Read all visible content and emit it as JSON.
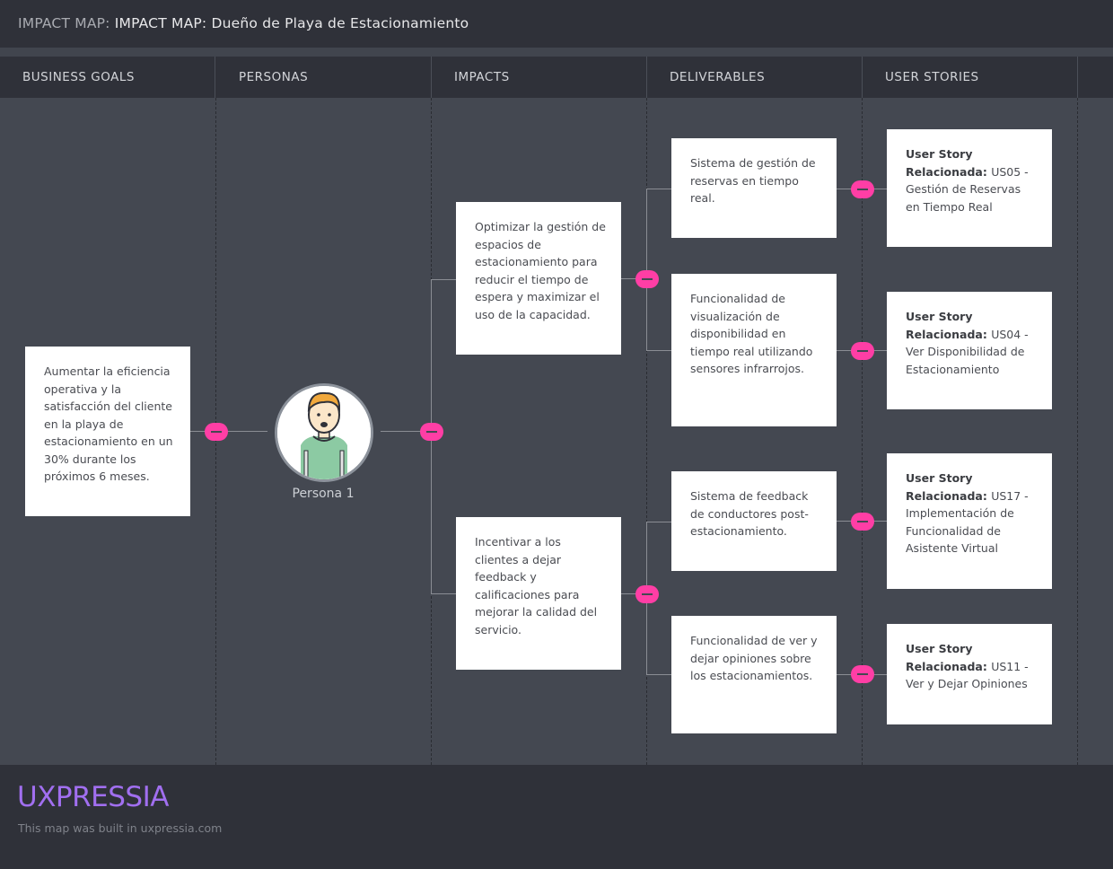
{
  "header": {
    "title_prefix": "IMPACT MAP:",
    "title": "IMPACT MAP: Dueño de Playa de Estacionamiento"
  },
  "columns": [
    "BUSINESS GOALS",
    "PERSONAS",
    "IMPACTS",
    "DELIVERABLES",
    "USER STORIES"
  ],
  "business_goal": {
    "text": "Aumentar la eficiencia operativa y la satisfacción del cliente en la playa de estacionamiento en un 30% durante los próximos 6 meses."
  },
  "persona": {
    "label": "Persona 1"
  },
  "impacts": [
    {
      "text": "Optimizar la gestión de espacios de estacionamiento para reducir el tiempo de espera y maximizar el uso de la capacidad."
    },
    {
      "text": "Incentivar a los clientes a dejar feedback y calificaciones para mejorar la calidad del servicio."
    }
  ],
  "deliverables": [
    {
      "text": "Sistema de gestión de reservas en tiempo real."
    },
    {
      "text": "Funcionalidad de visualización de disponibilidad en tiempo real utilizando sensores infrarrojos."
    },
    {
      "text": "Sistema de feedback de conductores post-estacionamiento."
    },
    {
      "text": "Funcionalidad de ver y dejar opiniones sobre los estacionamientos."
    }
  ],
  "user_stories": [
    {
      "label": "User Story Relacionada:",
      "text": "US05 - Gestión de Reservas en Tiempo Real"
    },
    {
      "label": "User Story Relacionada:",
      "text": "US04 - Ver Disponibilidad de Estacionamiento"
    },
    {
      "label": "User Story Relacionada:",
      "text": "US17 - Implementación de Funcionalidad de Asistente Virtual"
    },
    {
      "label": "User Story Relacionada:",
      "text": "US11 - Ver y Dejar Opiniones"
    }
  ],
  "footer": {
    "logo": "UXPRESSIA",
    "credit": "This map was built in uxpressia.com"
  },
  "colors": {
    "accent": "#ff3ea5",
    "logo": "#a16ff0",
    "canvas": "#444851",
    "header": "#2f3139"
  }
}
